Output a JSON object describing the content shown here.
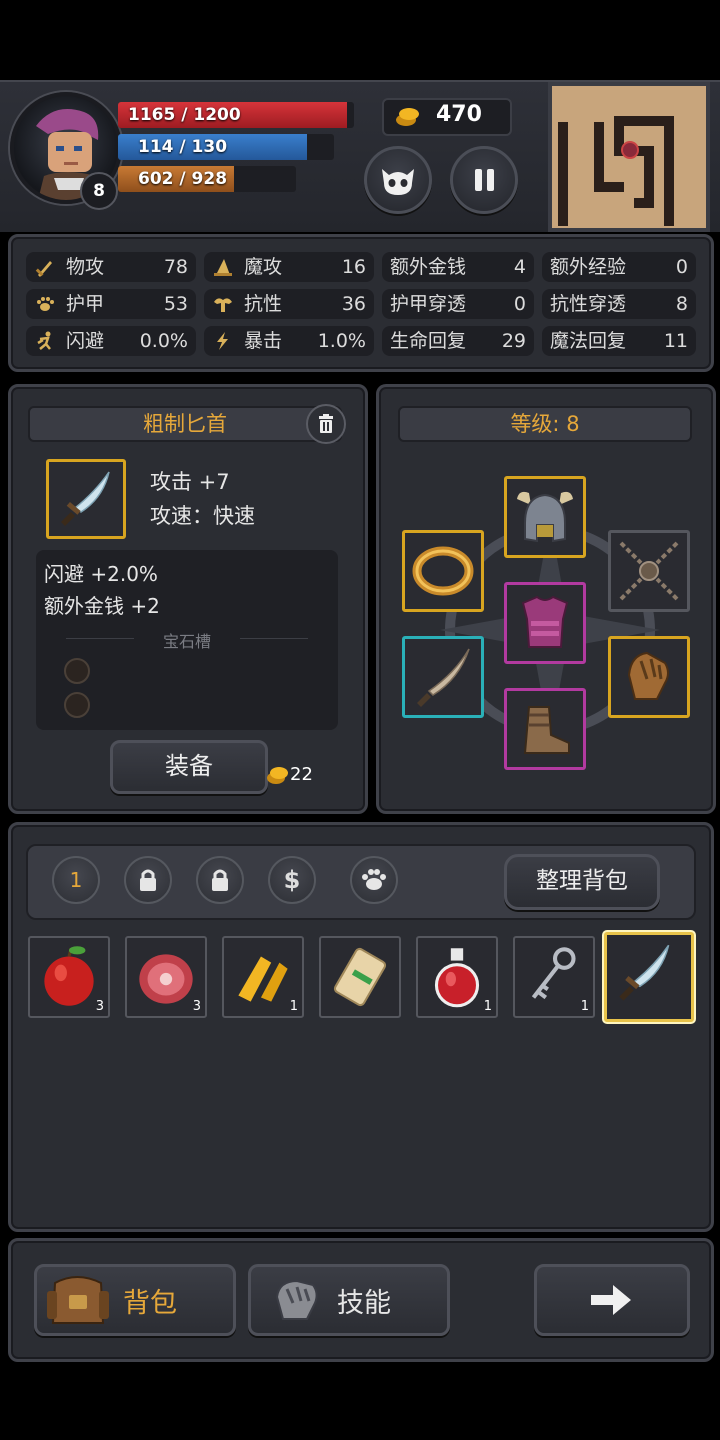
{
  "player": {
    "level": "8",
    "hp_text": "1165 / 1200",
    "hp_fraction": 0.971,
    "mp_text": "114 / 130",
    "mp_fraction": 0.877,
    "xp_text": "602 / 928",
    "xp_fraction": 0.649
  },
  "gold": "470",
  "stats": [
    {
      "label": "物攻",
      "value": "78",
      "icon": "sword-icon"
    },
    {
      "label": "魔攻",
      "value": "16",
      "icon": "wizard-hat-icon"
    },
    {
      "label": "额外金钱",
      "value": "4",
      "icon": ""
    },
    {
      "label": "额外经验",
      "value": "0",
      "icon": ""
    },
    {
      "label": "护甲",
      "value": "53",
      "icon": "paw-icon"
    },
    {
      "label": "抗性",
      "value": "36",
      "icon": "muscle-icon"
    },
    {
      "label": "护甲穿透",
      "value": "0",
      "icon": ""
    },
    {
      "label": "抗性穿透",
      "value": "8",
      "icon": ""
    },
    {
      "label": "闪避",
      "value": "0.0%",
      "icon": "running-icon"
    },
    {
      "label": "暴击",
      "value": "1.0%",
      "icon": "lightning-icon"
    },
    {
      "label": "生命回复",
      "value": "29",
      "icon": ""
    },
    {
      "label": "魔法回复",
      "value": "11",
      "icon": ""
    }
  ],
  "item": {
    "name": "粗制匕首",
    "attack": "攻击 +7",
    "speed": "攻速：快速",
    "bonus1": "闪避 +2.0%",
    "bonus2": "额外金钱 +2",
    "gem_slots_label": "宝石槽",
    "equip_label": "装备",
    "price": "22"
  },
  "equipment": {
    "level_label": "等级: 8"
  },
  "bag": {
    "tab_page": "1",
    "sort_label": "整理背包",
    "items": [
      {
        "name": "apple",
        "count": "3"
      },
      {
        "name": "meat",
        "count": "3"
      },
      {
        "name": "gold-crystal",
        "count": "1"
      },
      {
        "name": "scroll",
        "count": ""
      },
      {
        "name": "red-potion",
        "count": "1"
      },
      {
        "name": "key",
        "count": "1"
      },
      {
        "name": "dagger",
        "count": ""
      }
    ]
  },
  "bottom": {
    "bag_label": "背包",
    "skills_label": "技能"
  },
  "colors": {
    "hp": "#c1272d",
    "mp": "#2f6fb7",
    "xp": "#b86a2a",
    "accent": "#e6a83a"
  }
}
